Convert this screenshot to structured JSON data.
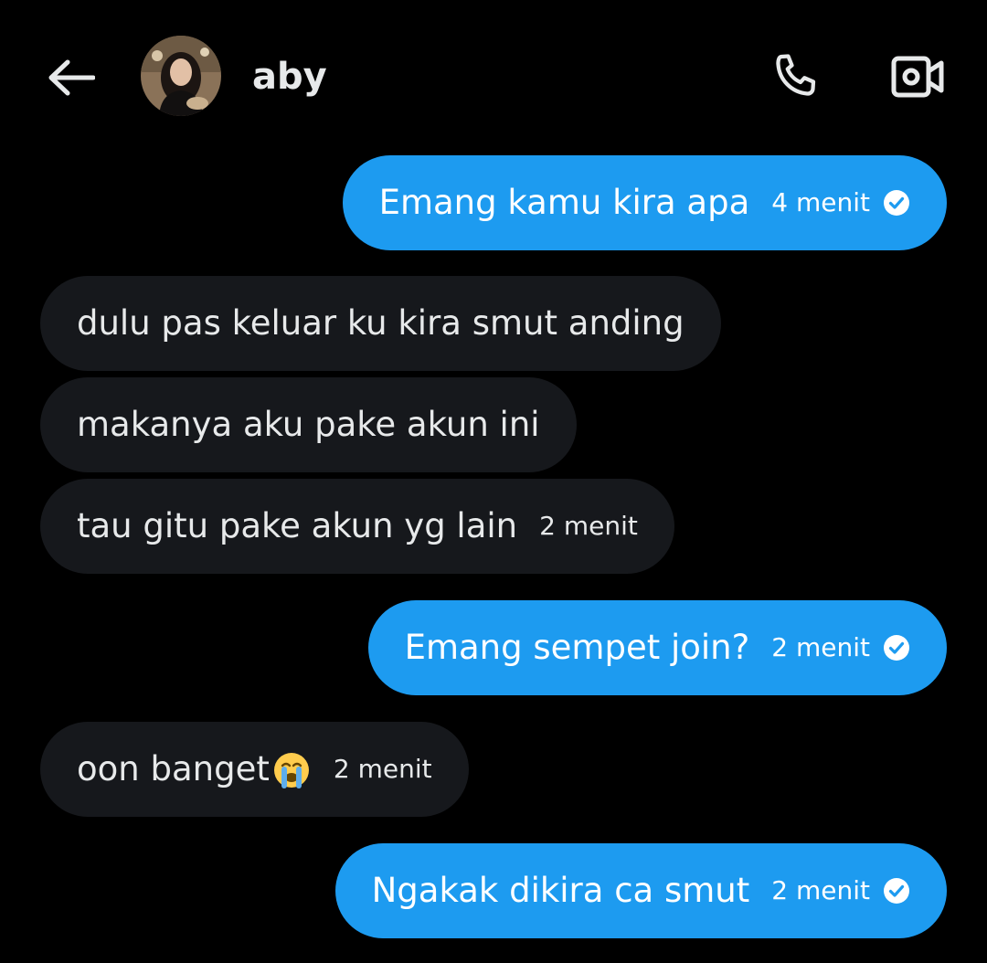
{
  "header": {
    "contact_name": "aby",
    "back_icon": "arrow-left-icon",
    "call_icon": "phone-icon",
    "video_icon": "video-camera-icon"
  },
  "colors": {
    "background": "#000000",
    "outgoing_bubble": "#1d9bf0",
    "incoming_bubble": "#16181c",
    "text": "#e7e9ea"
  },
  "messages": [
    {
      "direction": "out",
      "text": "Emang kamu kira apa",
      "time": "4 menit",
      "read": true
    },
    {
      "direction": "in",
      "text": "dulu pas keluar ku kira smut anding",
      "time": "",
      "read": false
    },
    {
      "direction": "in",
      "text": "makanya aku pake akun ini",
      "time": "",
      "read": false
    },
    {
      "direction": "in",
      "text": "tau gitu pake akun yg lain",
      "time": "2 menit",
      "read": false
    },
    {
      "direction": "out",
      "text": "Emang sempet join?",
      "time": "2 menit",
      "read": true
    },
    {
      "direction": "in",
      "text": "oon banget",
      "emoji": "loudly-crying-face-emoji",
      "time": "2 menit",
      "read": false
    },
    {
      "direction": "out",
      "text": "Ngakak dikira ca smut",
      "time": "2 menit",
      "read": true
    }
  ]
}
